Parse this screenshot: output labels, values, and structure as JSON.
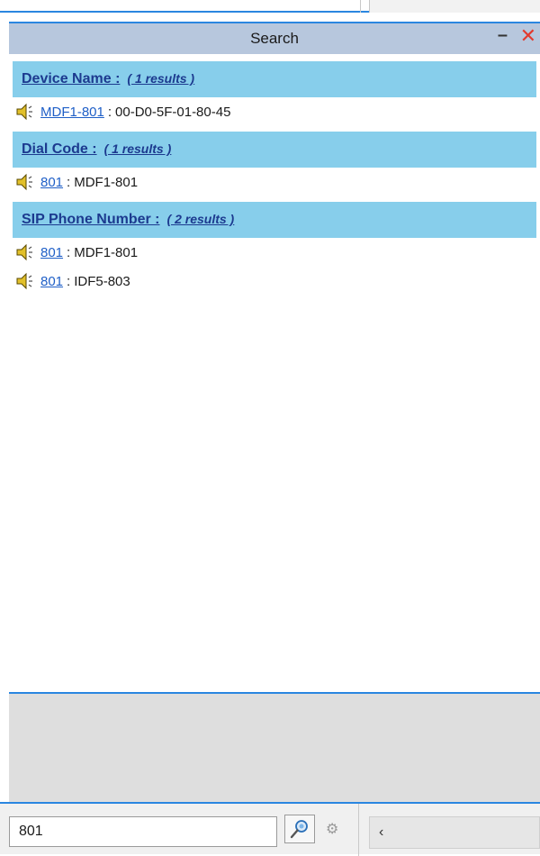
{
  "panel": {
    "title": "Search",
    "minimize_label": "–",
    "close_label": "✕"
  },
  "groups": [
    {
      "header": "Device Name :",
      "count": "( 1 results )",
      "results": [
        {
          "link": "MDF1-801",
          "sep": ":",
          "detail": "00-D0-5F-01-80-45",
          "icon": "speaker-icon"
        }
      ]
    },
    {
      "header": "Dial Code :",
      "count": "( 1 results )",
      "results": [
        {
          "link": "801",
          "sep": ":",
          "detail": "MDF1-801",
          "icon": "speaker-icon"
        }
      ]
    },
    {
      "header": "SIP Phone Number :",
      "count": "( 2 results )",
      "results": [
        {
          "link": "801",
          "sep": ":",
          "detail": "MDF1-801",
          "icon": "speaker-icon"
        },
        {
          "link": "801",
          "sep": ":",
          "detail": "IDF5-803",
          "icon": "speaker-icon"
        }
      ]
    }
  ],
  "search": {
    "value": "801"
  },
  "colors": {
    "accent": "#2a86e0",
    "group_header_bg": "#87ceeb",
    "panel_header_bg": "#b7c7dd",
    "close": "#e33a2e"
  }
}
